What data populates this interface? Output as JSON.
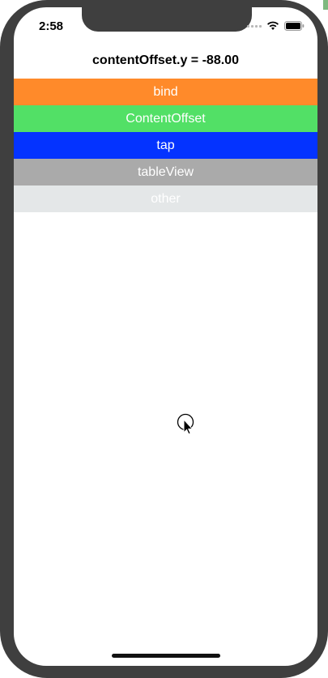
{
  "status_bar": {
    "time": "2:58",
    "icons": [
      "signal-icon",
      "wifi-icon",
      "battery-icon"
    ]
  },
  "navigation": {
    "title": "contentOffset.y = -88.00"
  },
  "menu": {
    "items": [
      {
        "label": "bind",
        "color": "#ff8a2a"
      },
      {
        "label": "ContentOffset",
        "color": "#52e066"
      },
      {
        "label": "tap",
        "color": "#0433ff"
      },
      {
        "label": "tableView",
        "color": "#aaaaaa"
      },
      {
        "label": "other",
        "color": "#e4e7e8"
      }
    ]
  },
  "cursor": {
    "icon": "pointer-cursor-icon"
  },
  "home_indicator": {
    "icon": "home-indicator"
  }
}
